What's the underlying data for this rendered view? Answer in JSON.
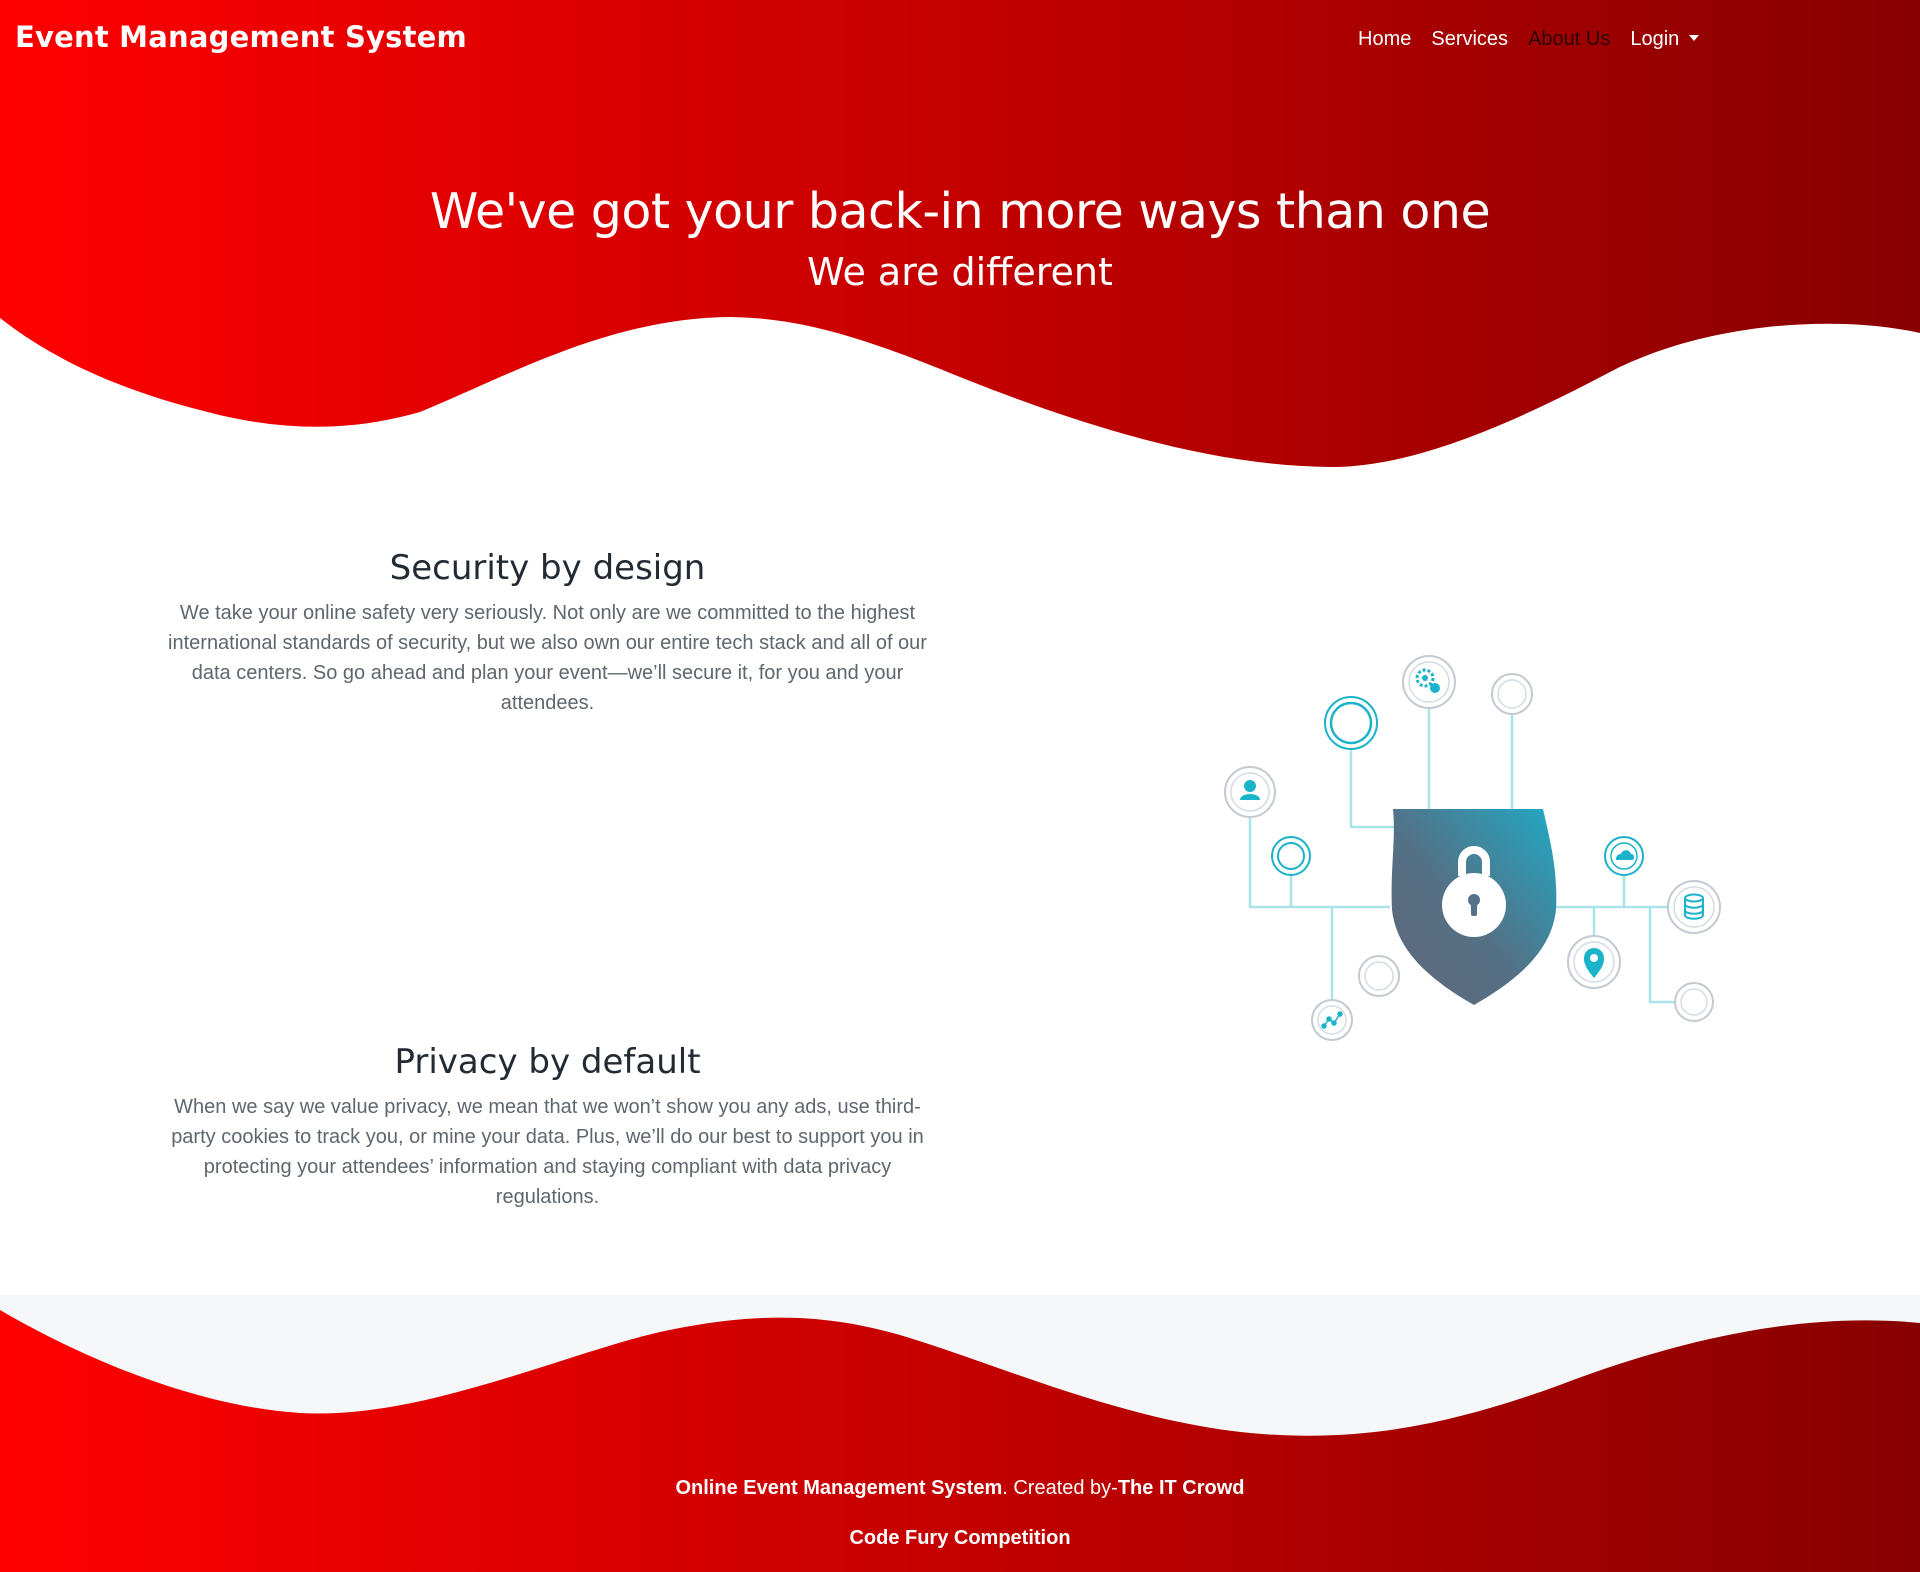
{
  "navbar": {
    "brand": "Event Management System",
    "links": [
      {
        "label": "Home"
      },
      {
        "label": "Services"
      },
      {
        "label": "About Us"
      },
      {
        "label": "Login"
      }
    ]
  },
  "hero": {
    "title": "We've got your back-in more ways than one",
    "subtitle": "We are different"
  },
  "features": [
    {
      "title": "Security by design",
      "text": "We take your online safety very seriously. Not only are we committed to the highest international standards of security, but we also own our entire tech stack and all of our data centers. So go ahead and plan your event—we’ll secure it, for you and your attendees."
    },
    {
      "title": "Privacy by default",
      "text": "When we say we value privacy, we mean that we won’t show you any ads, use third-party cookies to track you, or mine your data. Plus, we’ll do our best to support you in protecting your attendees’ information and staying compliant with data privacy regulations."
    }
  ],
  "footer": {
    "product": "Online Event Management System",
    "created_by_text": ". Created by-",
    "team": "The IT Crowd",
    "competition": "Code Fury Competition"
  },
  "colors": {
    "gradient_start": "#ff0000",
    "gradient_end": "#8a0000",
    "footer_bg": "#f5f7f9",
    "shield_top": "#2aa1bd",
    "shield_bottom": "#5e6b80",
    "accent": "#1ab3c9"
  },
  "icons": [
    "user-icon",
    "gear-icon",
    "lock-icon",
    "cloud-icon",
    "database-icon",
    "location-pin-icon",
    "graph-icon"
  ]
}
